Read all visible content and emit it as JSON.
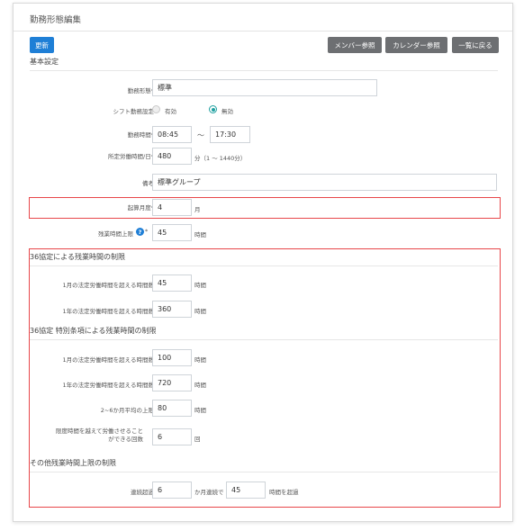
{
  "page_title": "勤務形態編集",
  "toolbar": {
    "update_label": "更新",
    "members_label": "メンバー参照",
    "calendar_label": "カレンダー参照",
    "back_label": "一覧に戻る"
  },
  "basic": {
    "section_title": "基本設定",
    "work_type_label": "勤務形態*",
    "work_type_value": "標準",
    "shift_label": "シフト勤務設定",
    "shift_enabled_label": "有効",
    "shift_disabled_label": "無効",
    "shift_selected": "無効",
    "work_time_label": "勤務時間*",
    "work_start": "08:45",
    "work_sep": "～",
    "work_end": "17:30",
    "fixed_minutes_label": "所定労働時間/日*",
    "fixed_minutes_value": "480",
    "fixed_minutes_unit": "分（1 ～ 1440分）",
    "note_label": "備考",
    "note_value": "標準グループ",
    "start_month_label": "起算月度*",
    "start_month_value": "4",
    "start_month_unit": "月",
    "overtime_cap_label": "残業時間上限",
    "overtime_cap_value": "45",
    "overtime_cap_unit": "時間"
  },
  "art36": {
    "section_title": "36協定による残業時間の制限",
    "monthly_label": "1月の法定労働時間を超える時間数",
    "monthly_value": "45",
    "yearly_label": "1年の法定労働時間を超える時間数",
    "yearly_value": "360",
    "unit_hours": "時間"
  },
  "special": {
    "section_title": "36協定 特別条項による残業時間の制限",
    "monthly_label": "1月の法定労働時間を超える時間数",
    "monthly_value": "100",
    "yearly_label": "1年の法定労働時間を超える時間数",
    "yearly_value": "720",
    "avg_label": "2~6か月平均の上限",
    "avg_value": "80",
    "count_label": "限度時間を越えて労働させることができる回数",
    "count_value": "6",
    "count_unit": "回",
    "unit_hours": "時間"
  },
  "other": {
    "section_title": "その他残業時間上限の制限",
    "consecutive_label": "連続超過",
    "consecutive_months_value": "6",
    "consecutive_mid_text": "か月連続で",
    "consecutive_hours_value": "45",
    "consecutive_end_text": "時間を超過"
  },
  "colors": {
    "primary": "#1f7fd6",
    "gray_button": "#6d6f72",
    "highlight_border": "#e8474a",
    "radio_on": "#1fa0a0"
  }
}
